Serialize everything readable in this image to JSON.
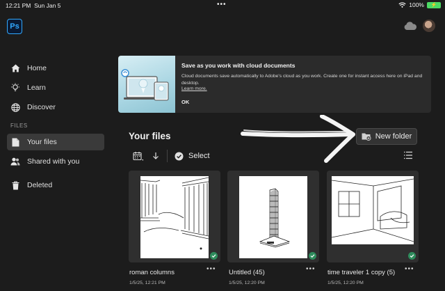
{
  "status_bar": {
    "time": "12:21 PM",
    "date": "Sun Jan 5",
    "battery": "100%"
  },
  "app": {
    "logo_text": "Ps"
  },
  "sidebar": {
    "items": [
      {
        "label": "Home",
        "icon": "home-icon"
      },
      {
        "label": "Learn",
        "icon": "lightbulb-icon"
      },
      {
        "label": "Discover",
        "icon": "globe-icon"
      }
    ],
    "section_label": "FILES",
    "file_items": [
      {
        "label": "Your files",
        "icon": "document-icon",
        "active": true
      },
      {
        "label": "Shared with you",
        "icon": "people-icon",
        "active": false
      },
      {
        "label": "Deleted",
        "icon": "trash-icon",
        "active": false
      }
    ]
  },
  "banner": {
    "title": "Save as you work with cloud documents",
    "body": "Cloud documents save automatically to Adobe's cloud as you work. Create one for instant access here on iPad and desktop.",
    "learn_more": "Learn more.",
    "ok": "OK"
  },
  "files": {
    "heading": "Your files",
    "new_folder": "New folder",
    "select": "Select",
    "items": [
      {
        "name": "roman columns",
        "date": "1/5/25, 12:21 PM"
      },
      {
        "name": "Untitled (45)",
        "date": "1/5/25, 12:20 PM"
      },
      {
        "name": "time traveler 1 copy (5)",
        "date": "1/5/25, 12:20 PM"
      }
    ]
  },
  "colors": {
    "accent_ps": "#31a8ff",
    "sync_check": "#2e8c5c",
    "battery": "#4cd964"
  }
}
